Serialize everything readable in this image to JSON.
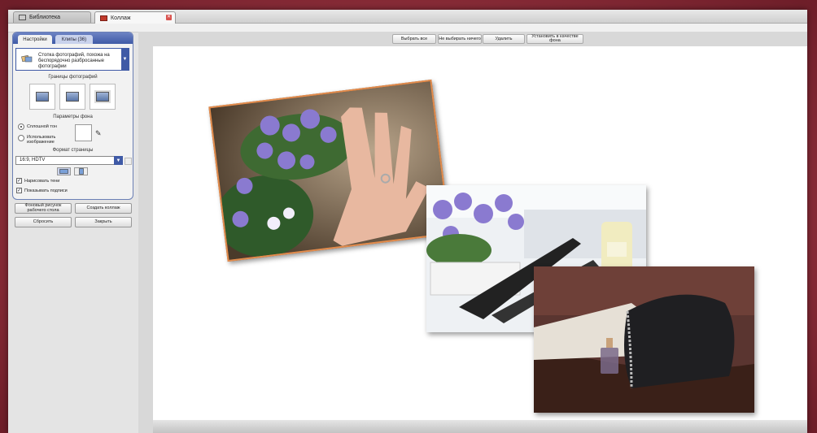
{
  "tabs": [
    {
      "label": "Библиотека"
    },
    {
      "label": "Коллаж"
    }
  ],
  "sidebar": {
    "tabs": [
      {
        "label": "Настройки"
      },
      {
        "label": "Клипы (36)"
      }
    ],
    "layout_text": "Стопка фотографий, похожа на беспорядочно разбросанные фотографии",
    "borders_label": "Границы фотографий",
    "background_label": "Параметры фона",
    "solid_color_label": "Сплошной тон",
    "use_image_label": "Использовать изображение",
    "page_format_label": "Формат страницы",
    "ratio_value": "16:9, HDTV",
    "draw_shadows_label": "Нарисовать тени",
    "show_captions_label": "Показывать подписи"
  },
  "buttons": {
    "wallpaper": "Фоновый рисунок рабочего стола",
    "create_collage": "Создать коллаж",
    "reset": "Сбросить",
    "close": "Закрыть"
  },
  "toolbar": {
    "select_all": "Выбрать все",
    "select_none": "Не выбирать ничего",
    "delete": "Удалить",
    "set_background": "Установить в качестве фона"
  },
  "colors": {
    "accent": "#3f5aa6",
    "photo_border": "#e38b4b",
    "desktop": "#8f2f3b"
  }
}
